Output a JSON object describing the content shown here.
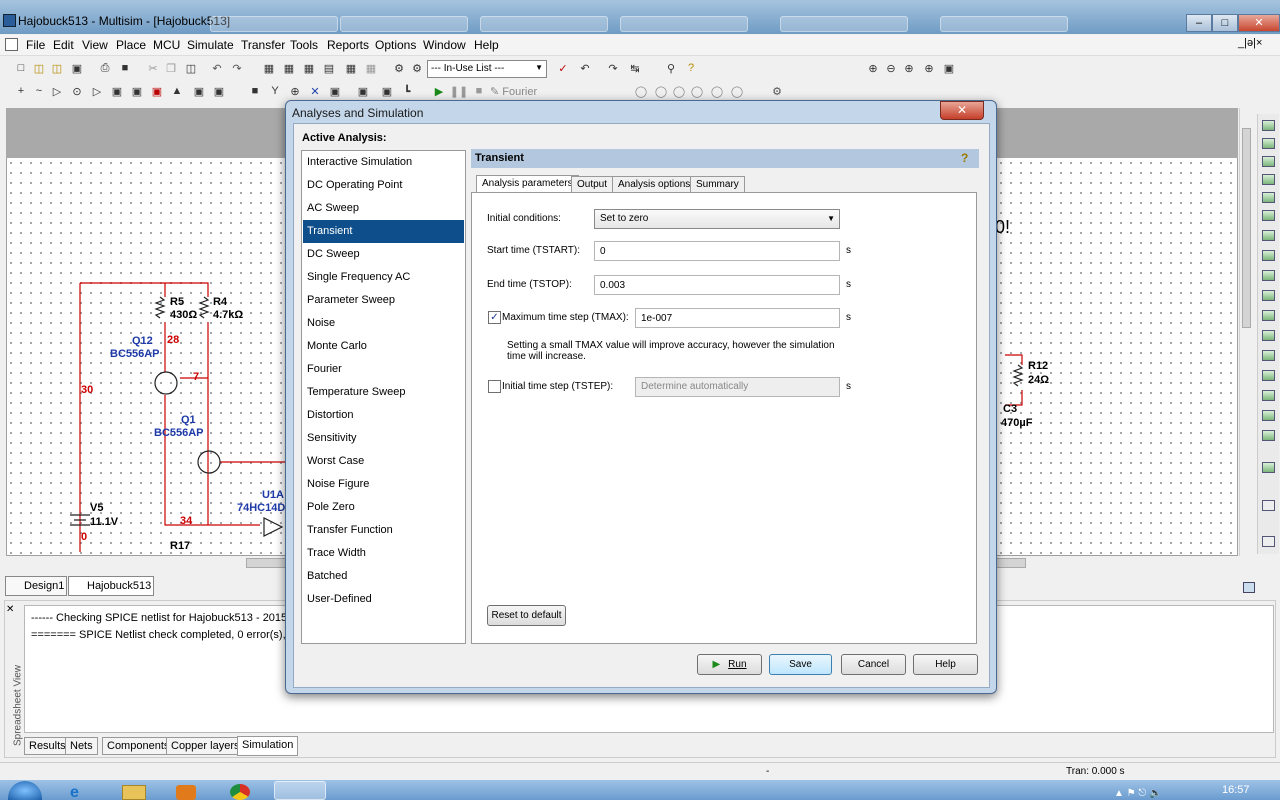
{
  "window": {
    "title": "Hajobuck513 - Multisim - [Hajobuck513]",
    "min": "–",
    "max": "□",
    "close": "✕"
  },
  "menu": [
    "File",
    "Edit",
    "View",
    "Place",
    "MCU",
    "Simulate",
    "Transfer",
    "Tools",
    "Reports",
    "Options",
    "Window",
    "Help"
  ],
  "mdi_controls": "_|ə|×",
  "toolbar": {
    "in_use_list": "--- In-Use List ---",
    "fourier": "Fourier"
  },
  "schematic": {
    "r5": "R5",
    "r5v": "430Ω",
    "r4": "R4",
    "r4v": "4.7kΩ",
    "q12": "Q12",
    "q12t": "BC556AP",
    "q1": "Q1",
    "q1t": "BC556AP",
    "n28": "28",
    "n7": "7",
    "n30": "30",
    "n34": "34",
    "n0": "0",
    "v5": "V5",
    "v5v": "11.1V",
    "u1a": "U1A",
    "u1t": "74HC14D",
    "r17": "R17",
    "r12": "R12",
    "r12v": "24Ω",
    "c3": "C3",
    "c3v": "470µF",
    "partial": "0!"
  },
  "design_tabs": [
    "Design1",
    "Hajobuck513"
  ],
  "log": [
    "------ Checking SPICE netlist for Hajobuck513 - 2015. c",
    "======= SPICE Netlist check completed, 0 error(s), 0"
  ],
  "spreadsheet_label": "Spreadsheet View",
  "bottom_tabs": [
    "Results",
    "Nets",
    "Components",
    "Copper layers",
    "Simulation"
  ],
  "status": {
    "dash": "-",
    "tran": "Tran: 0.000 s"
  },
  "clock": "16:57",
  "dialog": {
    "title": "Analyses and Simulation",
    "active_label": "Active Analysis:",
    "analyses": [
      "Interactive Simulation",
      "DC Operating Point",
      "AC Sweep",
      "Transient",
      "DC Sweep",
      "Single Frequency AC",
      "Parameter Sweep",
      "Noise",
      "Monte Carlo",
      "Fourier",
      "Temperature Sweep",
      "Distortion",
      "Sensitivity",
      "Worst Case",
      "Noise Figure",
      "Pole Zero",
      "Transfer Function",
      "Trace Width",
      "Batched",
      "User-Defined"
    ],
    "selected": "Transient",
    "panel_title": "Transient",
    "tabs": [
      "Analysis parameters",
      "Output",
      "Analysis options",
      "Summary"
    ],
    "initial_conditions_label": "Initial conditions:",
    "initial_conditions_value": "Set to zero",
    "tstart_label": "Start time (TSTART):",
    "tstart_value": "0",
    "tstop_label": "End time (TSTOP):",
    "tstop_value": "0.003",
    "tmax_label": "Maximum time step (TMAX):",
    "tmax_value": "1e-007",
    "tmax_checked": true,
    "hint": "Setting a small TMAX value will improve accuracy, however the simulation time will increase.",
    "tstep_label": "Initial time step (TSTEP):",
    "tstep_value": "Determine automatically",
    "tstep_checked": false,
    "unit": "s",
    "reset_label": "Reset to default",
    "run_label": "Run",
    "save_label": "Save",
    "cancel_label": "Cancel",
    "help_label": "Help"
  }
}
